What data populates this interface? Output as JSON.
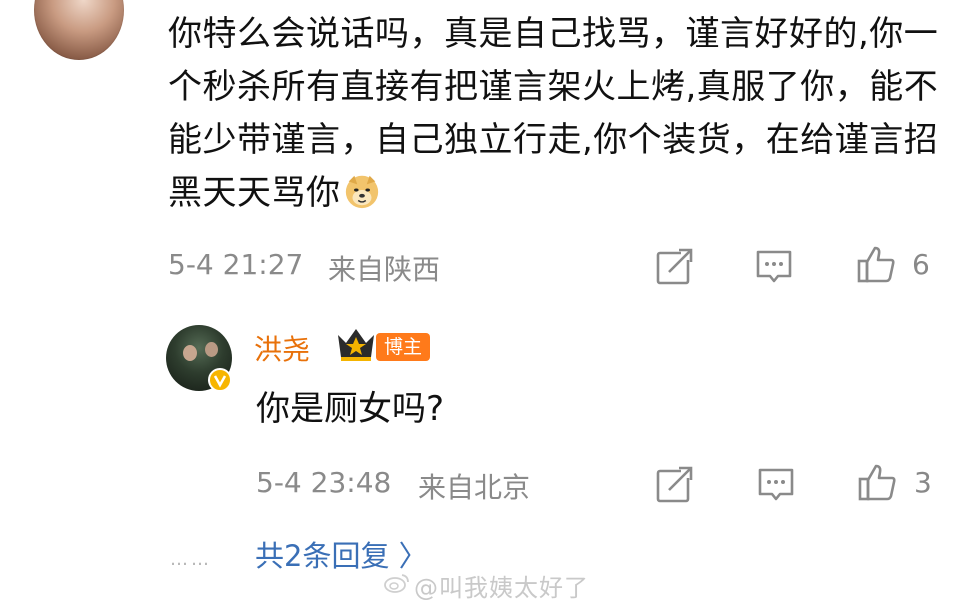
{
  "comment": {
    "text": "你特么会说话吗，真是自己找骂，谨言好好的,你一个秒杀所有直接有把谨言架火上烤,真服了你，能不能少带谨言，自己独立行走,你个装货，在给谨言招黑天天骂你",
    "emoji": "doge-emoji",
    "time": "5-4 21:27",
    "location": "来自陕西",
    "like_count": "6"
  },
  "reply": {
    "author": "洪尧",
    "badge": "博主",
    "text": "你是厕女吗?",
    "time": "5-4 23:48",
    "location": "来自北京",
    "like_count": "3"
  },
  "thread": {
    "dots": "……",
    "more_replies": "共2条回复 〉"
  },
  "watermark": "@叫我姨太好了",
  "icons": [
    "share-icon",
    "comment-icon",
    "like-icon",
    "crown-icon",
    "verified-icon",
    "weibo-logo-icon"
  ],
  "colors": {
    "name": "#e8710a",
    "badge": "#ff7a1a",
    "link": "#3a6fb6",
    "meta": "#8a8a8a"
  }
}
